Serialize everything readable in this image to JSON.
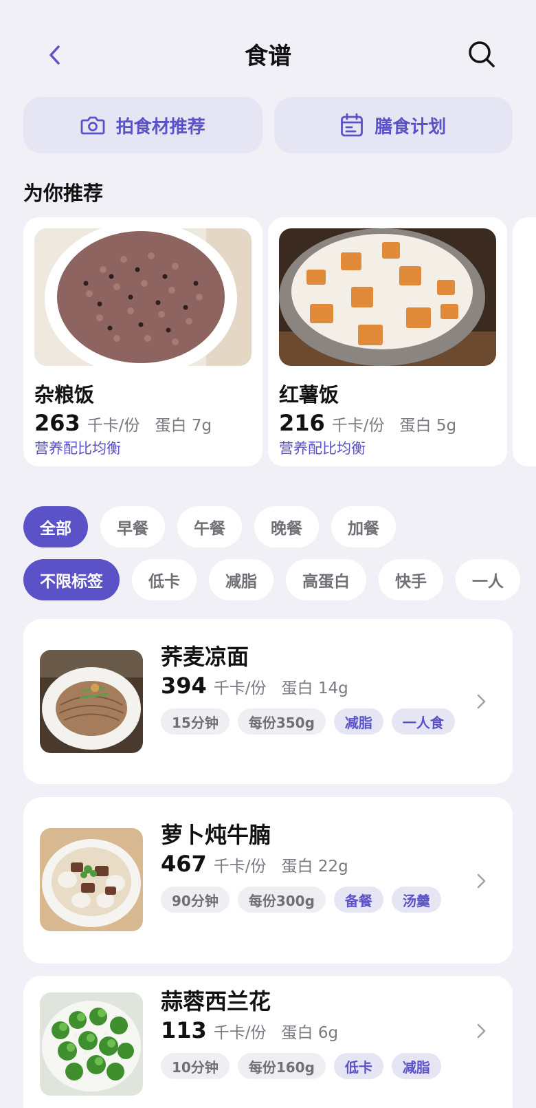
{
  "header": {
    "title": "食谱",
    "back_icon": "chevron-left-icon",
    "search_icon": "search-icon"
  },
  "quick_actions": [
    {
      "label": "拍食材推荐",
      "icon": "camera-icon"
    },
    {
      "label": "膳食计划",
      "icon": "calendar-icon"
    }
  ],
  "recommend": {
    "title": "为你推荐",
    "items": [
      {
        "name": "杂粮饭",
        "kcal": "263",
        "kcal_unit": "千卡/份",
        "protein": "蛋白 7g",
        "note": "营养配比均衡"
      },
      {
        "name": "红薯饭",
        "kcal": "216",
        "kcal_unit": "千卡/份",
        "protein": "蛋白 5g",
        "note": "营养配比均衡"
      }
    ]
  },
  "meal_filters": {
    "items": [
      "全部",
      "早餐",
      "午餐",
      "晚餐",
      "加餐"
    ],
    "active": "全部"
  },
  "tag_filters": {
    "items": [
      "不限标签",
      "低卡",
      "减脂",
      "高蛋白",
      "快手",
      "一人"
    ],
    "active": "不限标签"
  },
  "recipes": [
    {
      "name": "荞麦凉面",
      "kcal": "394",
      "kcal_unit": "千卡/份",
      "protein": "蛋白 14g",
      "tags": [
        {
          "text": "15分钟",
          "accent": false
        },
        {
          "text": "每份350g",
          "accent": false
        },
        {
          "text": "减脂",
          "accent": true
        },
        {
          "text": "一人食",
          "accent": true
        }
      ]
    },
    {
      "name": "萝卜炖牛腩",
      "kcal": "467",
      "kcal_unit": "千卡/份",
      "protein": "蛋白 22g",
      "tags": [
        {
          "text": "90分钟",
          "accent": false
        },
        {
          "text": "每份300g",
          "accent": false
        },
        {
          "text": "备餐",
          "accent": true
        },
        {
          "text": "汤羹",
          "accent": true
        }
      ]
    },
    {
      "name": "蒜蓉西兰花",
      "kcal": "113",
      "kcal_unit": "千卡/份",
      "protein": "蛋白 6g",
      "tags": [
        {
          "text": "10分钟",
          "accent": false
        },
        {
          "text": "每份160g",
          "accent": false
        },
        {
          "text": "低卡",
          "accent": true
        },
        {
          "text": "减脂",
          "accent": true
        }
      ]
    }
  ],
  "colors": {
    "accent": "#5a52c6",
    "accent_light": "#e6e5f4",
    "background": "#f1f0f6"
  }
}
